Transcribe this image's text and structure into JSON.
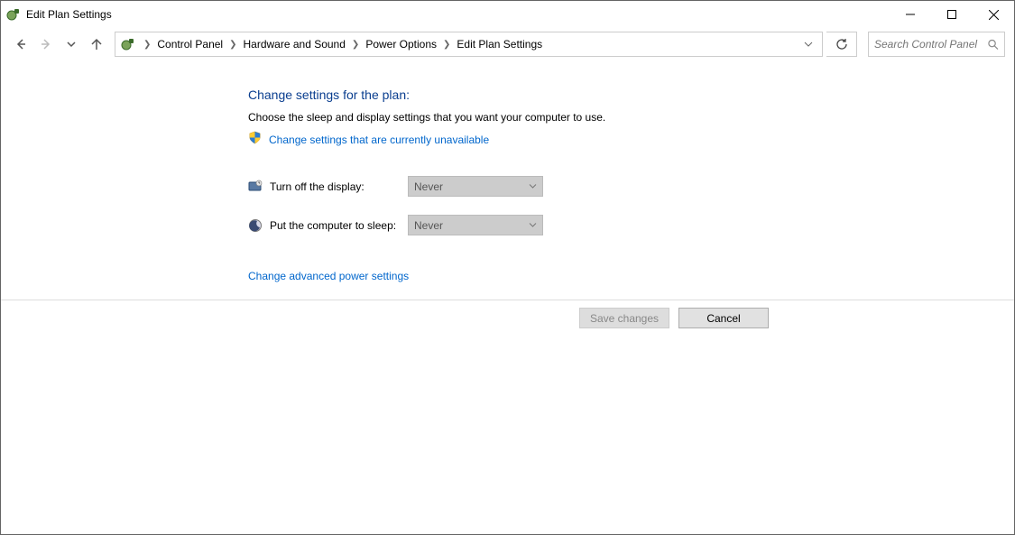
{
  "window": {
    "title": "Edit Plan Settings"
  },
  "breadcrumb": {
    "items": [
      "Control Panel",
      "Hardware and Sound",
      "Power Options",
      "Edit Plan Settings"
    ]
  },
  "search": {
    "placeholder": "Search Control Panel"
  },
  "main": {
    "heading": "Change settings for the plan:",
    "subtext": "Choose the sleep and display settings that you want your computer to use.",
    "uac_link": "Change settings that are currently unavailable",
    "setting_display": {
      "label": "Turn off the display:",
      "value": "Never"
    },
    "setting_sleep": {
      "label": "Put the computer to sleep:",
      "value": "Never"
    },
    "adv_link": "Change advanced power settings"
  },
  "footer": {
    "save_label": "Save changes",
    "cancel_label": "Cancel"
  }
}
